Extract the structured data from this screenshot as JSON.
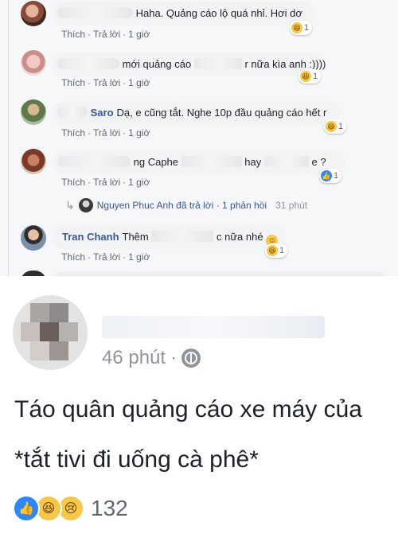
{
  "comments": [
    {
      "author": "",
      "text": "Haha. Quảng cáo lộ quá nhỉ. Hơi dơ",
      "actions": {
        "like": "Thích",
        "reply": "Trả lời",
        "time": "1 giờ"
      },
      "reaction": {
        "icon": "haha-emoji",
        "count": "1"
      }
    },
    {
      "author": "",
      "text_a": "mới quảng cáo",
      "text_b": "r nữa kìa anh :))))",
      "actions": {
        "like": "Thích",
        "reply": "Trả lời",
        "time": "1 giờ"
      },
      "reaction": {
        "icon": "haha-emoji",
        "count": "1"
      }
    },
    {
      "author": "Saro",
      "text": "Dạ, e cũng tắt. Nghe 10p đầu quảng cáo hết r",
      "actions": {
        "like": "Thích",
        "reply": "Trả lời",
        "time": "1 giờ"
      },
      "reaction": {
        "icon": "haha-emoji",
        "count": "1"
      }
    },
    {
      "author": "",
      "text_a": "ng Caphe",
      "text_b": "hay",
      "text_c": "e ?",
      "actions": {
        "like": "Thích",
        "reply": "Trả lời",
        "time": "1 giờ"
      },
      "reaction": {
        "icon": "like-emoji",
        "count": "1"
      }
    },
    {
      "author": "Tran Chanh",
      "text_a": "Thêm",
      "text_b": "c nữa nhé",
      "actions": {
        "like": "Thích",
        "reply": "Trả lời",
        "time": "1 giờ"
      },
      "reaction": {
        "icon": "haha-emoji",
        "count": "1"
      }
    }
  ],
  "reply_summary": {
    "text": "Nguyen Phuc Anh đã trả lời · 1 phản hồi",
    "time": "31 phút"
  },
  "post": {
    "time": "46 phút",
    "dot": "·",
    "privacy_icon": "globe-icon",
    "line1": "Táo quân quảng cáo xe máy của",
    "line2": "*tắt tivi đi uống cà phê*",
    "reaction_icons": [
      "like-emoji",
      "haha-emoji",
      "sad-emoji"
    ],
    "reaction_count": "132"
  },
  "colors": {
    "link": "#385898",
    "meta": "#606770",
    "like_blue": "#2d88ff",
    "emoji_yellow": "#f7c848"
  }
}
